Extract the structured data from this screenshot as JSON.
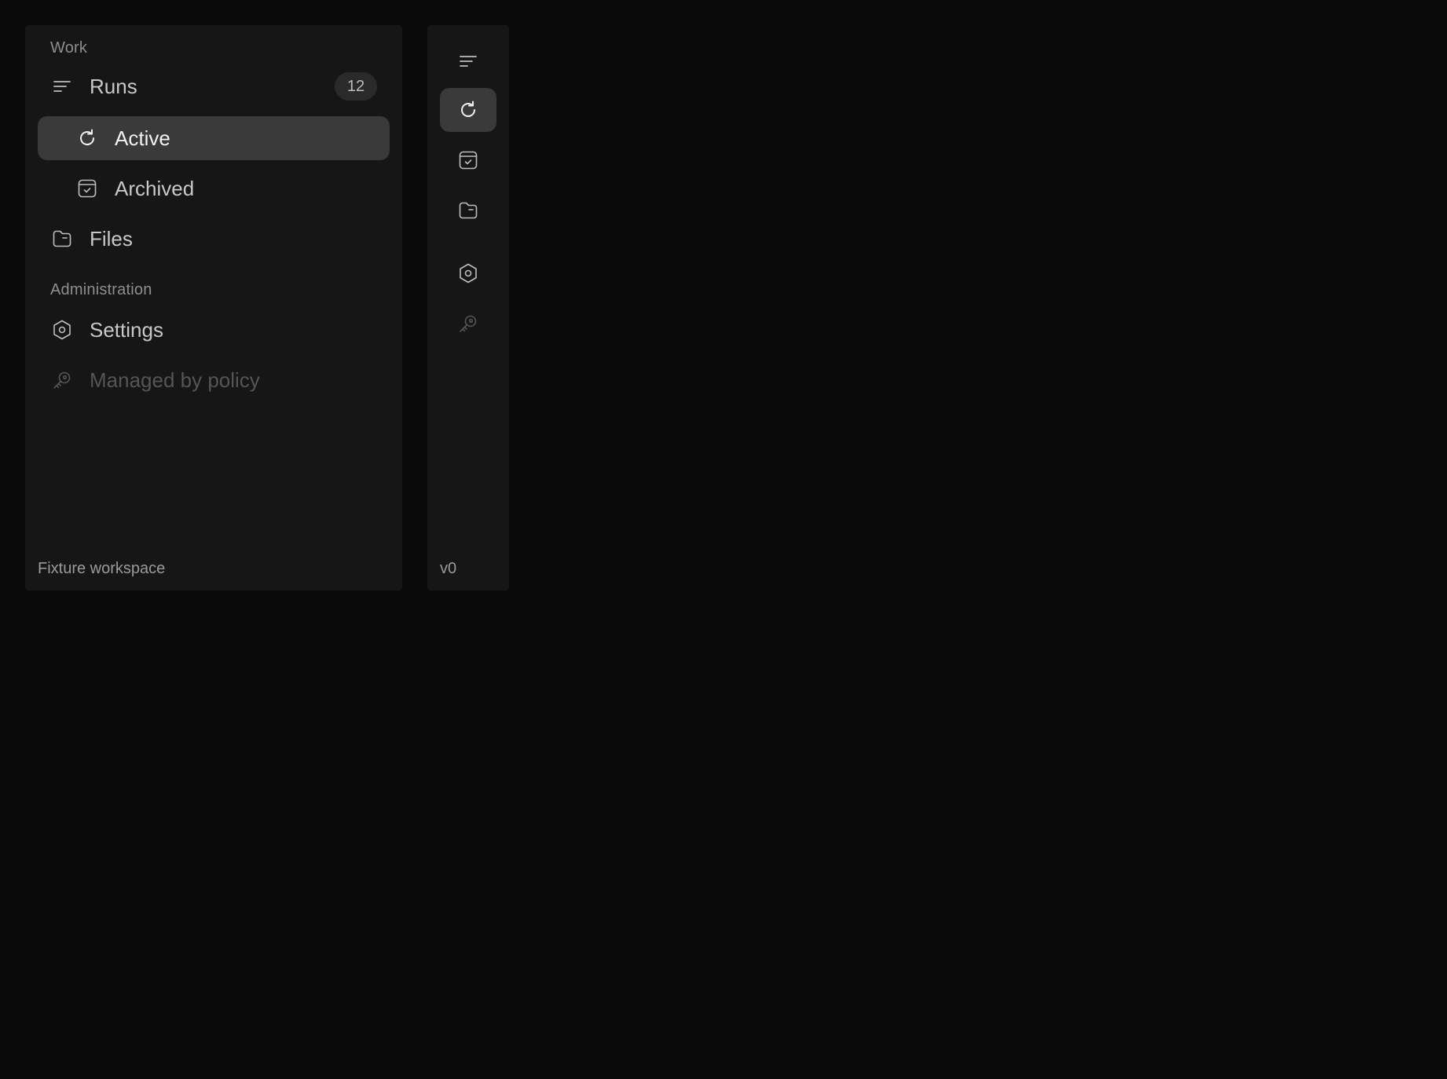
{
  "sidebar": {
    "section_work": "Work",
    "runs": {
      "label": "Runs",
      "badge": "12",
      "icon": "filter-lines-icon"
    },
    "active": {
      "label": "Active",
      "icon": "refresh-icon",
      "selected": true
    },
    "archived": {
      "label": "Archived",
      "icon": "archive-box-icon"
    },
    "files": {
      "label": "Files",
      "icon": "folder-icon"
    },
    "section_admin": "Administration",
    "settings": {
      "label": "Settings",
      "icon": "hexagon-gear-icon"
    },
    "managed": {
      "label": "Managed by policy",
      "icon": "key-icon",
      "disabled": true
    },
    "footer": "Fixture workspace"
  },
  "rail": {
    "footer": "v0",
    "items": [
      "filter-lines-icon",
      "refresh-icon",
      "archive-box-icon",
      "folder-icon",
      "hexagon-gear-icon",
      "key-icon"
    ]
  },
  "colors": {
    "background": "#0a0a0a",
    "panel": "#161616",
    "selected": "#3a3a3a",
    "text": "#c8c8c8",
    "muted": "#8e8e8e",
    "disabled": "#555555"
  }
}
